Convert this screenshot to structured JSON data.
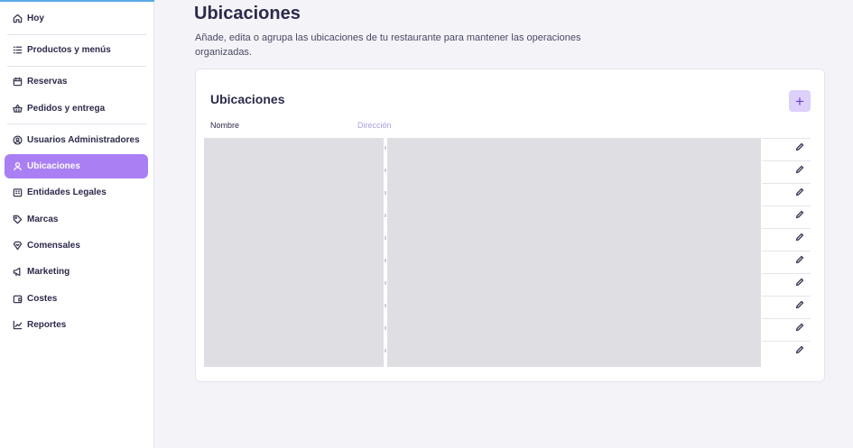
{
  "sidebar": {
    "items": [
      {
        "label": "Hoy",
        "icon": "home-icon"
      },
      {
        "label": "Productos y menús",
        "icon": "list-icon"
      },
      {
        "label": "Reservas",
        "icon": "calendar-icon"
      },
      {
        "label": "Pedidos y entrega",
        "icon": "basket-icon"
      },
      {
        "label": "Usuarios Administradores",
        "icon": "user-circle-icon"
      },
      {
        "label": "Ubicaciones",
        "icon": "location-user-icon"
      },
      {
        "label": "Entidades Legales",
        "icon": "building-icon"
      },
      {
        "label": "Marcas",
        "icon": "tag-icon"
      },
      {
        "label": "Comensales",
        "icon": "heart-badge-icon"
      },
      {
        "label": "Marketing",
        "icon": "megaphone-icon"
      },
      {
        "label": "Costes",
        "icon": "wallet-icon"
      },
      {
        "label": "Reportes",
        "icon": "chart-icon"
      }
    ],
    "active_item": "Ubicaciones"
  },
  "main": {
    "title": "Ubicaciones",
    "description": "Añade, edita o agrupa las ubicaciones de tu restaurante para mantener las operaciones organizadas."
  },
  "card": {
    "title": "Ubicaciones",
    "add_label": "+",
    "columns": [
      "Nombre",
      "Dirección"
    ],
    "row_count": 10,
    "row_action_icon": "pencil-icon"
  },
  "colors": {
    "accent": "#a97ff3",
    "add_button_bg": "#ddd0fb",
    "redaction": "#dfdfe3",
    "page_bg": "#f4f4f8"
  }
}
